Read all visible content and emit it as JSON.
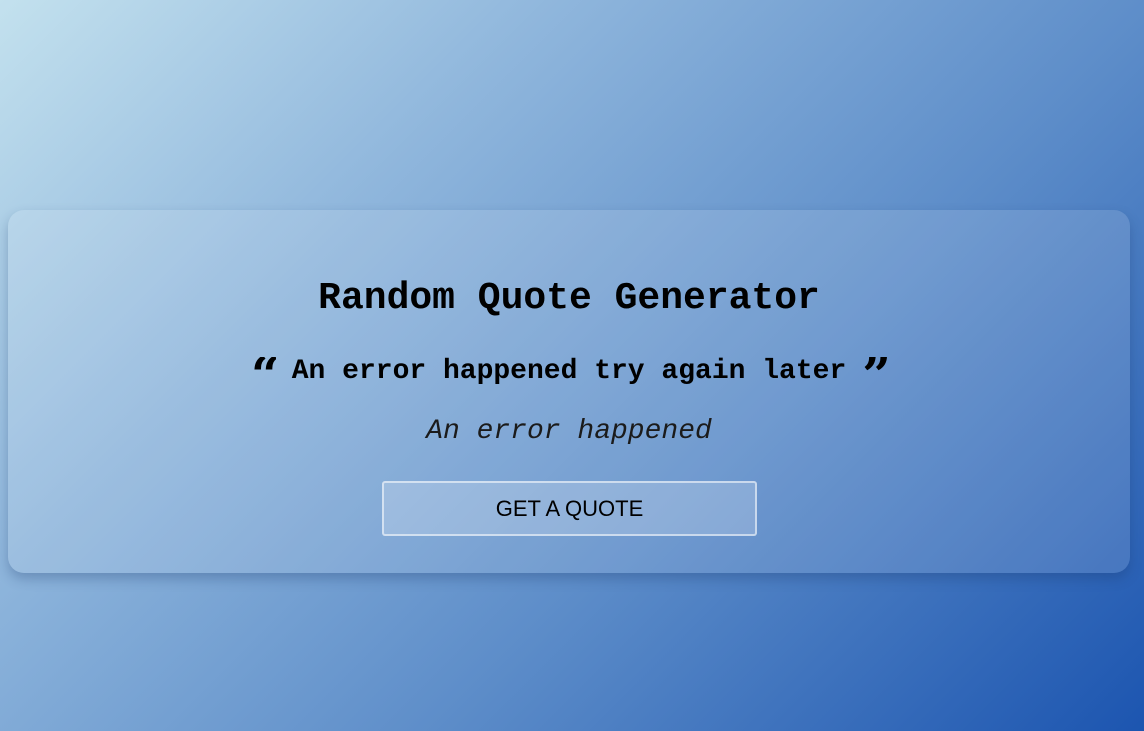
{
  "card": {
    "title": "Random Quote Generator",
    "quote_text": "An error happened try again later",
    "open_quote_icon": "quote-left-icon",
    "close_quote_icon": "quote-right-icon",
    "author": "An error happened",
    "button_label": "GET A QUOTE"
  },
  "colors": {
    "gradient_start": "#c3e1ee",
    "gradient_end": "#1c55b0",
    "text": "#000000"
  }
}
